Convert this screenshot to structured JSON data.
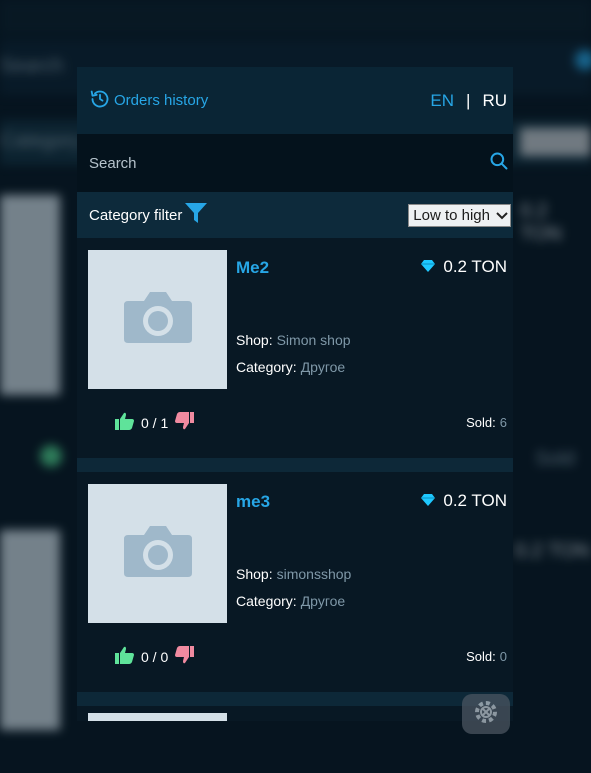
{
  "header": {
    "orders_history_label": "Orders history",
    "lang_en": "EN",
    "lang_separator": "|",
    "lang_ru": "RU"
  },
  "search": {
    "placeholder": "Search"
  },
  "filters": {
    "category_filter_label": "Category filter",
    "sort_selected": "Low to high"
  },
  "products": [
    {
      "name": "Me2",
      "price": "0.2 TON",
      "shop_label": "Shop:",
      "shop": "Simon shop",
      "category_label": "Category:",
      "category": "Другое",
      "votes": "0 / 1",
      "sold_label": "Sold:",
      "sold": "6"
    },
    {
      "name": "me3",
      "price": "0.2 TON",
      "shop_label": "Shop:",
      "shop": "simonsshop",
      "category_label": "Category:",
      "category": "Другое",
      "votes": "0 / 0",
      "sold_label": "Sold:",
      "sold": "0"
    }
  ],
  "colors": {
    "accent": "#27a6e6",
    "panel_bg": "#081824",
    "like": "#5fe39a",
    "dislike": "#f08aa0",
    "diamond": "#1ec8ff"
  },
  "icons": {
    "orders": "history-icon",
    "search": "search-icon",
    "filter": "filter-icon",
    "price": "diamond-icon",
    "like": "thumbs-up-icon",
    "dislike": "thumbs-down-icon",
    "placeholder": "camera-icon"
  }
}
